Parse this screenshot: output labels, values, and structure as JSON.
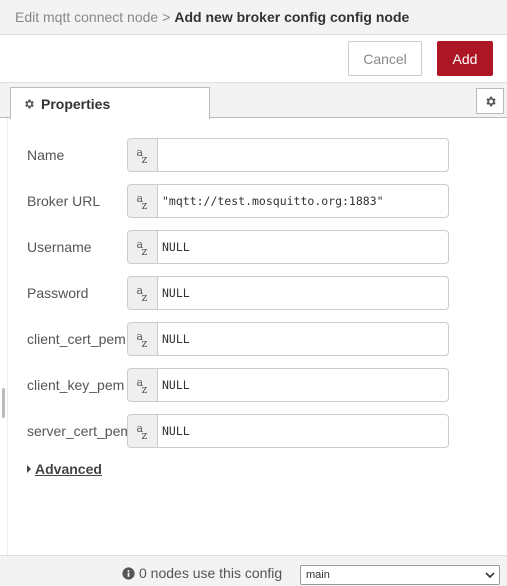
{
  "header": {
    "breadcrumb_prev": "Edit mqtt connect node",
    "breadcrumb_sep": ">",
    "breadcrumb_current": "Add new broker config config node"
  },
  "toolbar": {
    "cancel_label": "Cancel",
    "add_label": "Add"
  },
  "tabs": {
    "properties_label": "Properties"
  },
  "form": {
    "fields": [
      {
        "label": "Name",
        "value": ""
      },
      {
        "label": "Broker URL",
        "value": "\"mqtt://test.mosquitto.org:1883\""
      },
      {
        "label": "Username",
        "value": "NULL"
      },
      {
        "label": "Password",
        "value": "NULL"
      },
      {
        "label": "client_cert_pem",
        "value": "NULL"
      },
      {
        "label": "client_key_pem",
        "value": "NULL"
      },
      {
        "label": "server_cert_pem",
        "value": "NULL"
      }
    ],
    "type_icon_a": "a",
    "type_icon_z": "z",
    "advanced_label": "Advanced"
  },
  "footer": {
    "usage_text": "0 nodes use this config",
    "scope_selected": "main"
  },
  "colors": {
    "accent": "#ad1625"
  }
}
